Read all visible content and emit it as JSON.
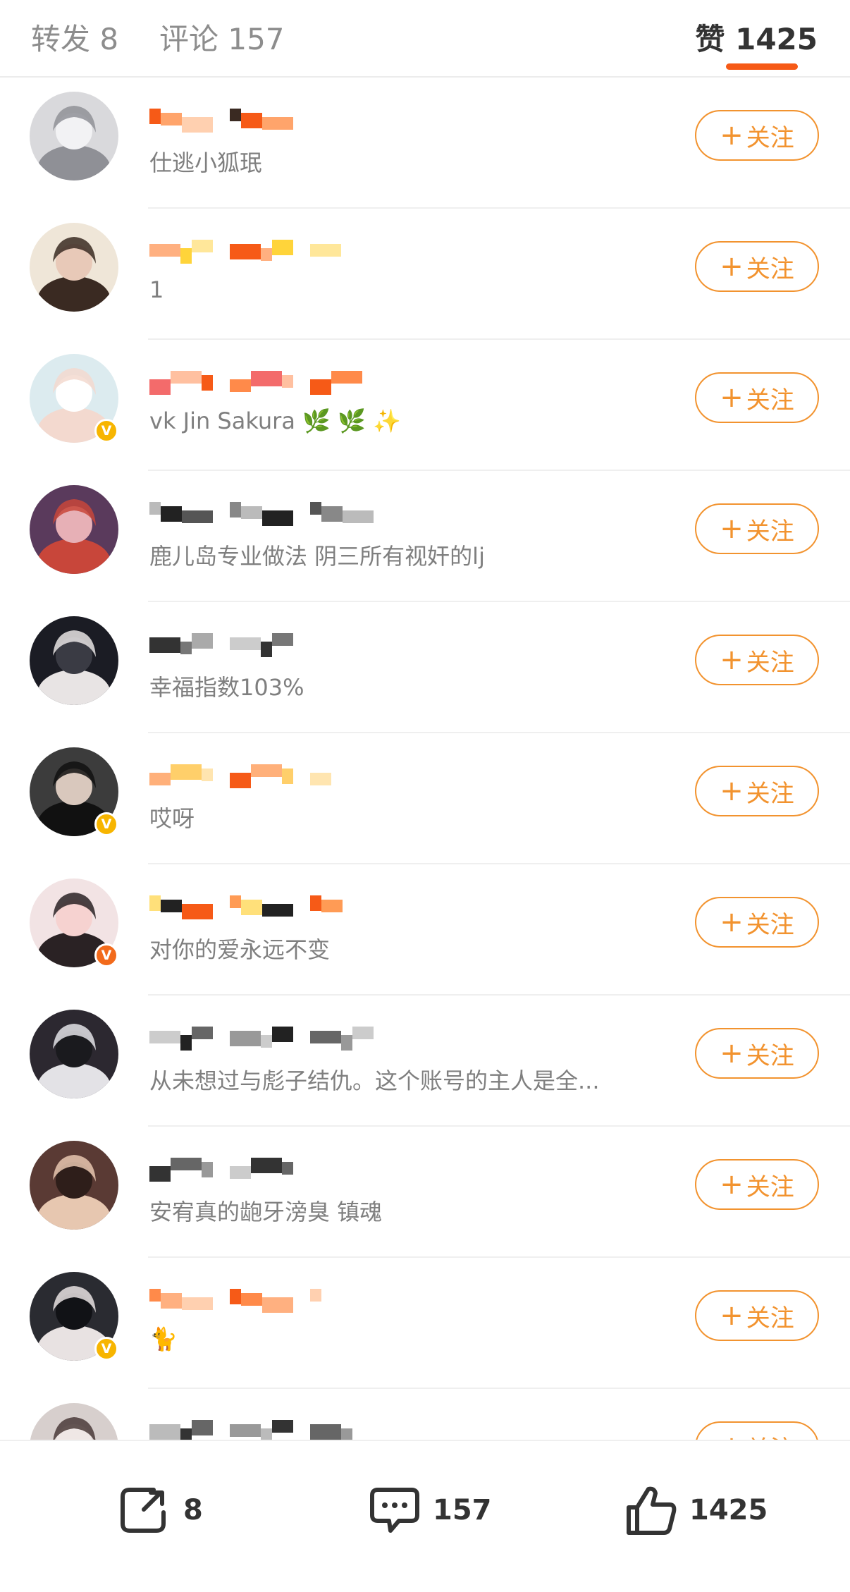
{
  "tabs": {
    "repost": "转发 8",
    "comment": "评论 157",
    "like": "赞 1425"
  },
  "follow_label": "关注",
  "follow_plus": "+",
  "verified_mark": "V",
  "users": [
    {
      "desc": "仕逃小狐珉",
      "verified": false,
      "avatar_colors": [
        "#d9d9dc",
        "#8f9096",
        "#f2f2f4"
      ]
    },
    {
      "desc": "1",
      "verified": false,
      "avatar_colors": [
        "#efe6d8",
        "#3a2a22",
        "#e8c9b8"
      ]
    },
    {
      "desc": "vk Jin Sakura 🌿 🌿 ✨",
      "verified": true,
      "badge_color": "#f7b500",
      "avatar_colors": [
        "#dcebef",
        "#f3d9cf",
        "#ffffff"
      ]
    },
    {
      "desc": "鹿儿岛专业做法 阴三所有视奸的lj",
      "verified": false,
      "avatar_colors": [
        "#5a3a5c",
        "#c8463a",
        "#e7b0b6"
      ]
    },
    {
      "desc": "幸福指数103%",
      "verified": false,
      "avatar_colors": [
        "#1b1c24",
        "#e8e4e4",
        "#3a3b44"
      ]
    },
    {
      "desc": "哎呀",
      "verified": true,
      "badge_color": "#f7b500",
      "avatar_colors": [
        "#3c3c3c",
        "#111111",
        "#d9c8bd"
      ]
    },
    {
      "desc": "对你的爱永远不变",
      "verified": true,
      "badge_color": "#f26a1b",
      "avatar_colors": [
        "#f2e3e4",
        "#2a2224",
        "#f6d2d0"
      ]
    },
    {
      "desc": "从未想过与彪子结仇。这个账号的主人是全...",
      "verified": false,
      "avatar_colors": [
        "#2c2830",
        "#e3e2e6",
        "#1a1a1e"
      ]
    },
    {
      "desc": "安宥真的龅牙滂臭 镇魂",
      "verified": false,
      "avatar_colors": [
        "#5a3a34",
        "#e7c7b0",
        "#2e1e1a"
      ]
    },
    {
      "desc": "🐈",
      "verified": true,
      "badge_color": "#f7b500",
      "avatar_colors": [
        "#2a2b31",
        "#e8e2e2",
        "#111216"
      ]
    },
    {
      "desc": "",
      "verified": false,
      "avatar_colors": [
        "#d7cfcd",
        "#4a3a38",
        "#efe7e5"
      ]
    }
  ],
  "toolbar": {
    "repost_count": "8",
    "comment_count": "157",
    "like_count": "1425"
  }
}
